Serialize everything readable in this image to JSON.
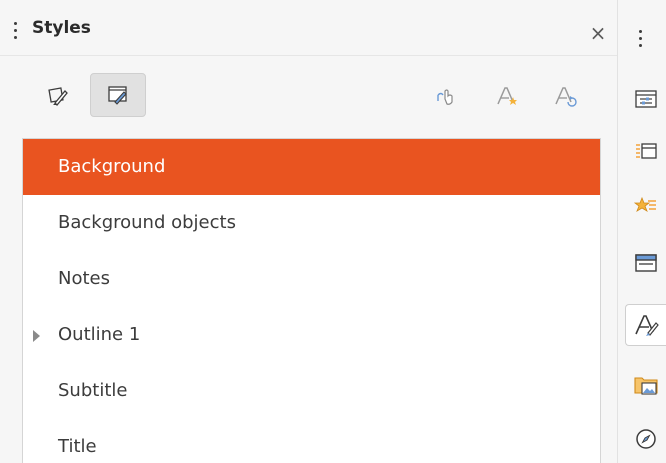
{
  "panel": {
    "title": "Styles",
    "close_glyph": "×"
  },
  "toolbar": {
    "left_buttons": [
      {
        "icon": "drawing-styles-icon"
      },
      {
        "icon": "presentation-styles-icon",
        "active": true
      }
    ],
    "right_buttons": [
      {
        "icon": "fill-format-mode-icon"
      },
      {
        "icon": "new-style-from-selection-icon"
      },
      {
        "icon": "update-style-icon"
      }
    ]
  },
  "styles_list": {
    "items": [
      {
        "label": "Background",
        "selected": true
      },
      {
        "label": "Background objects"
      },
      {
        "label": "Notes"
      },
      {
        "label": "Outline 1",
        "expandable": true
      },
      {
        "label": "Subtitle"
      },
      {
        "label": "Title"
      }
    ]
  },
  "sidebar": {
    "buttons": [
      {
        "icon": "properties-icon"
      },
      {
        "icon": "slide-transition-icon"
      },
      {
        "icon": "animation-icon"
      },
      {
        "icon": "master-slides-icon"
      },
      {
        "icon": "styles-icon",
        "active": true
      },
      {
        "icon": "gallery-icon"
      },
      {
        "icon": "navigator-icon"
      }
    ]
  },
  "colors": {
    "accent": "#e95420",
    "panel_bg": "#f6f6f6",
    "list_bg": "#ffffff"
  }
}
